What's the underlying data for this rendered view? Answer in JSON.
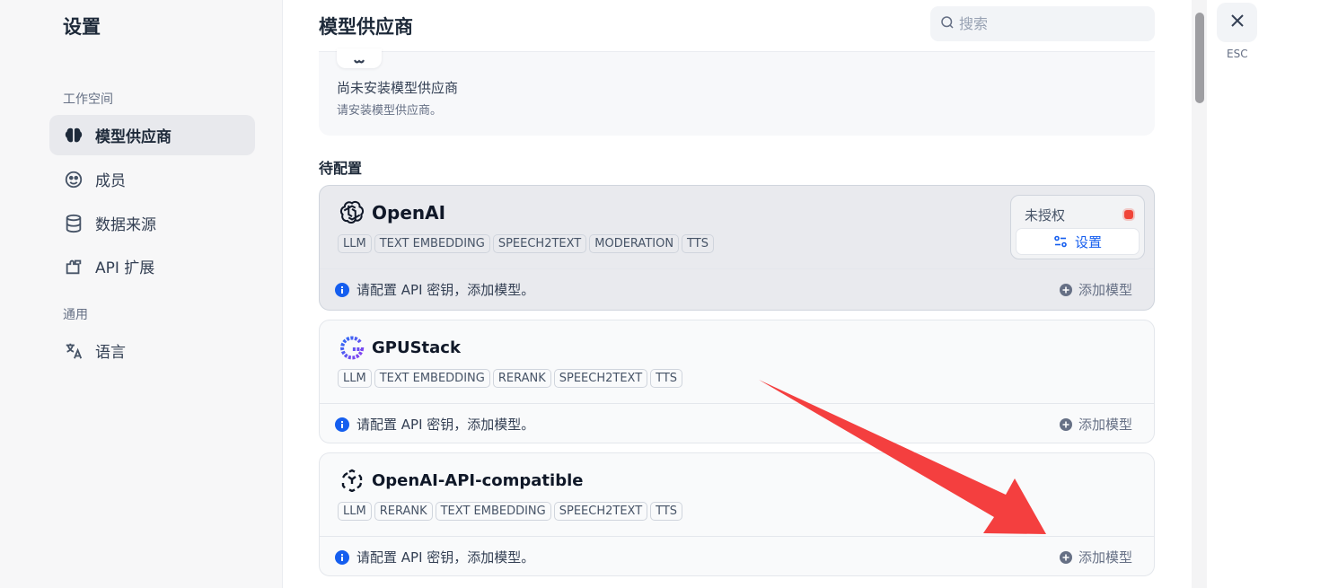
{
  "sidebar": {
    "title": "设置",
    "workspace_label": "工作空间",
    "items": [
      {
        "label": "模型供应商",
        "icon": "brain-icon"
      },
      {
        "label": "成员",
        "icon": "members-icon"
      },
      {
        "label": "数据来源",
        "icon": "database-icon"
      },
      {
        "label": "API 扩展",
        "icon": "puzzle-icon"
      }
    ],
    "general_label": "通用",
    "general_items": [
      {
        "label": "语言",
        "icon": "translate-icon"
      }
    ]
  },
  "main": {
    "title": "模型供应商",
    "search_placeholder": "搜索",
    "empty": {
      "title": "尚未安装模型供应商",
      "subtitle": "请安装模型供应商。"
    },
    "section_title": "待配置",
    "providers": [
      {
        "name": "OpenAI",
        "tags": [
          "LLM",
          "TEXT EMBEDDING",
          "SPEECH2TEXT",
          "MODERATION",
          "TTS"
        ],
        "hint": "请配置 API 密钥，添加模型。",
        "add_label": "添加模型",
        "auth_status": "未授权",
        "setup_label": "设置"
      },
      {
        "name": "GPUStack",
        "tags": [
          "LLM",
          "TEXT EMBEDDING",
          "RERANK",
          "SPEECH2TEXT",
          "TTS"
        ],
        "hint": "请配置 API 密钥，添加模型。",
        "add_label": "添加模型"
      },
      {
        "name": "OpenAI-API-compatible",
        "tags": [
          "LLM",
          "RERANK",
          "TEXT EMBEDDING",
          "SPEECH2TEXT",
          "TTS"
        ],
        "hint": "请配置 API 密钥，添加模型。",
        "add_label": "添加模型"
      }
    ]
  },
  "close": {
    "esc_label": "ESC"
  },
  "colors": {
    "accent": "#155eef",
    "status_unauthorized": "#f04438",
    "annotation_arrow": "#f43f3f"
  }
}
